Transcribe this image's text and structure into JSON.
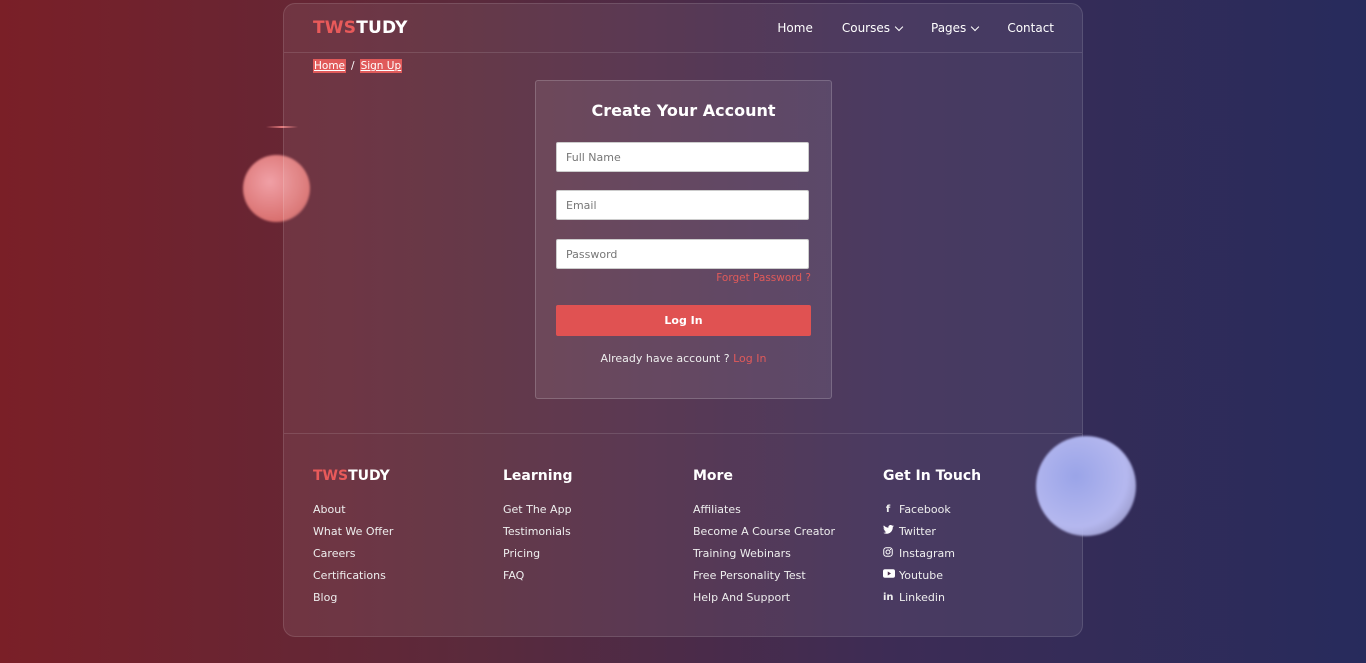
{
  "header": {
    "logo": {
      "part1": "TWS",
      "part2": "TUDY"
    },
    "nav": [
      {
        "label": "Home",
        "dropdown": false
      },
      {
        "label": "Courses",
        "dropdown": true
      },
      {
        "label": "Pages",
        "dropdown": true
      },
      {
        "label": "Contact",
        "dropdown": false
      }
    ]
  },
  "breadcrumb": {
    "home": "Home",
    "separator": "/",
    "current": "Sign Up"
  },
  "form": {
    "title": "Create Your Account",
    "fullname_placeholder": "Full Name",
    "email_placeholder": "Email",
    "password_placeholder": "Password",
    "forget_password": "Forget Password ?",
    "submit_label": "Log In",
    "already_text": "Already have account ?",
    "already_link": "Log In"
  },
  "footer": {
    "brand": {
      "part1": "TWS",
      "part2": "TUDY",
      "links": [
        "About",
        "What We Offer",
        "Careers",
        "Certifications",
        "Blog"
      ]
    },
    "learning": {
      "title": "Learning",
      "links": [
        "Get The App",
        "Testimonials",
        "Pricing",
        "FAQ"
      ]
    },
    "more": {
      "title": "More",
      "links": [
        "Affiliates",
        "Become A Course Creator",
        "Training Webinars",
        "Free Personality Test",
        "Help And Support"
      ]
    },
    "contact": {
      "title": "Get In Touch",
      "links": [
        {
          "label": "Facebook",
          "icon": "facebook-icon"
        },
        {
          "label": "Twitter",
          "icon": "twitter-icon"
        },
        {
          "label": "Instagram",
          "icon": "instagram-icon"
        },
        {
          "label": "Youtube",
          "icon": "youtube-icon"
        },
        {
          "label": "Linkedin",
          "icon": "linkedin-icon"
        }
      ]
    }
  },
  "colors": {
    "accent": "#e05a5a",
    "bg_left": "#7a1f27",
    "bg_right": "#272b5c"
  }
}
